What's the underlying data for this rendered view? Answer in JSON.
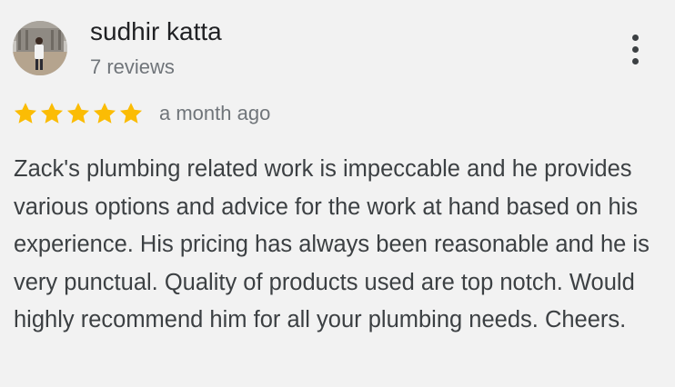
{
  "review": {
    "reviewer_name": "sudhir katta",
    "review_count": "7 reviews",
    "rating": 5,
    "rating_max": 5,
    "date": "a month ago",
    "text": "Zack's plumbing related work is impeccable and he provides various options and advice for the work at hand based on his experience. His pricing has always been reasonable and he is very punctual. Quality of products used are top notch. Would highly recommend him for all your plumbing needs. Cheers."
  },
  "icons": {
    "star": "star-icon",
    "more": "more-vert-icon"
  },
  "colors": {
    "background": "#f2f2f2",
    "star": "#fbbc04",
    "primary_text": "#202124",
    "secondary_text": "#70757a",
    "body_text": "#3c4043"
  }
}
